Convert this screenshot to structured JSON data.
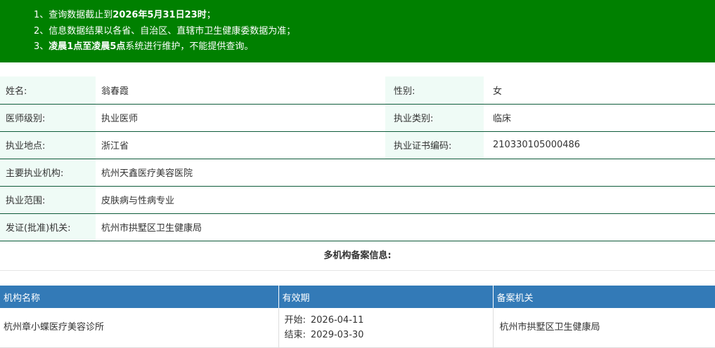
{
  "notice": {
    "line1": {
      "prefix": "1、查询数据截止到",
      "bold": "2026年5月31日23时",
      "suffix": "；"
    },
    "line2": {
      "text": "2、信息数据结果以各省、自治区、直辖市卫生健康委数据为准；"
    },
    "line3": {
      "prefix": "3、",
      "bold": "凌晨1点至凌晨5点",
      "suffix": "系统进行维护，不能提供查询。"
    }
  },
  "doctor": {
    "name_label": "姓名:",
    "name": "翁春霞",
    "gender_label": "性别:",
    "gender": "女",
    "level_label": "医师级别:",
    "level": "执业医师",
    "category_label": "执业类别:",
    "category": "临床",
    "location_label": "执业地点:",
    "location": "浙江省",
    "cert_label": "执业证书编码:",
    "cert_no": "210330105000486",
    "institution_label": "主要执业机构:",
    "institution": "杭州天鑫医疗美容医院",
    "scope_label": "执业范围:",
    "scope": "皮肤病与性病专业",
    "authority_label": "发证(批准)机关:",
    "authority": "杭州市拱墅区卫生健康局"
  },
  "multi": {
    "title": "多机构备案信息:",
    "headers": [
      "机构名称",
      "有效期",
      "备案机关"
    ],
    "rows": [
      {
        "name": "杭州章小蝶医疗美容诊所",
        "start_label": "开始:",
        "start": "2026-04-11",
        "end_label": "结束:",
        "end": "2029-03-30",
        "authority": "杭州市拱墅区卫生健康局"
      }
    ]
  }
}
